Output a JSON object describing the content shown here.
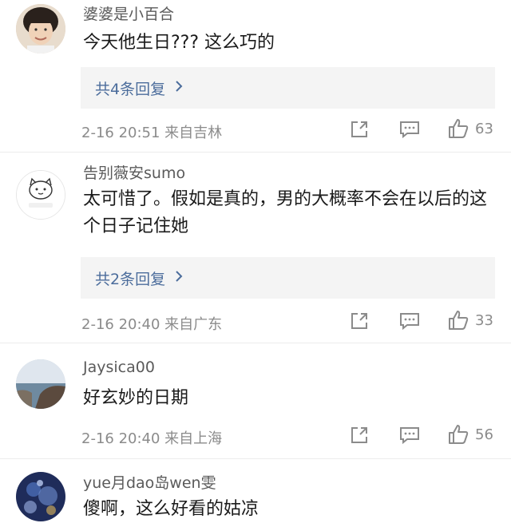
{
  "comments": [
    {
      "username": "婆婆是小百合",
      "text": "今天他生日??? 这么巧的",
      "replies_label": "共4条回复",
      "meta": "2-16 20:51 来自吉林",
      "likes": "63"
    },
    {
      "username": "告别薇安sumo",
      "text": "太可惜了。假如是真的，男的大概率不会在以后的这个日子记住她",
      "replies_label": "共2条回复",
      "meta": "2-16 20:40 来自广东",
      "likes": "33"
    },
    {
      "username": "Jaysica00",
      "text": "好玄妙的日期",
      "meta": "2-16 20:40 来自上海",
      "likes": "56"
    },
    {
      "username": "yue月dao岛wen雯",
      "text": "傻啊，这么好看的姑凉"
    }
  ],
  "icons": {
    "share": "share-icon",
    "comment": "comment-icon",
    "like": "thumbs-up-icon",
    "reply_chevron": "chevron-right-icon"
  },
  "colors": {
    "reply_link": "#4c6d9c",
    "reply_bg": "#f4f4f4",
    "meta_text": "#8b8b8b"
  }
}
